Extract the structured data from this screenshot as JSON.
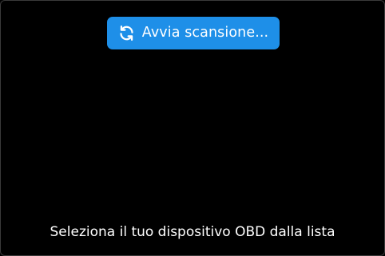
{
  "app": {
    "scan_button": {
      "label": "Avvia scansione...",
      "icon": "refresh-icon",
      "color": "#1e8fe8"
    },
    "instruction_text": "Seleziona il tuo dispositivo OBD dalla lista",
    "background_color": "#000000"
  }
}
